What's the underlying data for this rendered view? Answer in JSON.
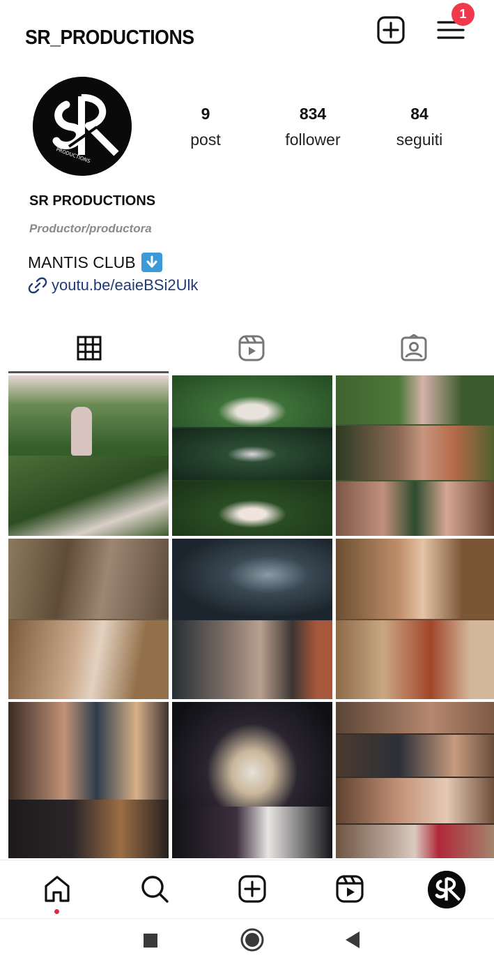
{
  "header": {
    "username": "SR_PRODUCTIONS",
    "add_icon": "plus-square-icon",
    "menu_icon": "hamburger-menu-icon",
    "notification_count": "1"
  },
  "profile": {
    "avatar_icon": "sr-productions-logo",
    "stats": [
      {
        "value": "9",
        "label": "post"
      },
      {
        "value": "834",
        "label": "follower"
      },
      {
        "value": "84",
        "label": "seguiti"
      }
    ],
    "full_name": "SR PRODUCTIONS",
    "category": "Productor/productora",
    "bio": "MANTIS CLUB",
    "bio_emoji": "down-arrow-emoji",
    "link": "youtu.be/eaieBSi2Ulk"
  },
  "tabs": [
    {
      "name": "grid-icon",
      "active": true
    },
    {
      "name": "reels-icon",
      "active": false
    },
    {
      "name": "tagged-icon",
      "active": false
    }
  ],
  "grid_colors": {
    "forest": "#2f5a26",
    "dark_green": "#1d3a1c",
    "warm_wood": "#7a5b3c",
    "dark_blue": "#2c3742",
    "stage": "#1a1a22"
  },
  "bottom_nav": [
    {
      "name": "home-icon",
      "active": true
    },
    {
      "name": "search-icon",
      "active": false
    },
    {
      "name": "create-icon",
      "active": false
    },
    {
      "name": "reels-icon",
      "active": false
    },
    {
      "name": "profile-avatar",
      "active": false
    }
  ],
  "system_nav": [
    {
      "name": "recents-square-icon"
    },
    {
      "name": "home-circle-icon"
    },
    {
      "name": "back-triangle-icon"
    }
  ]
}
